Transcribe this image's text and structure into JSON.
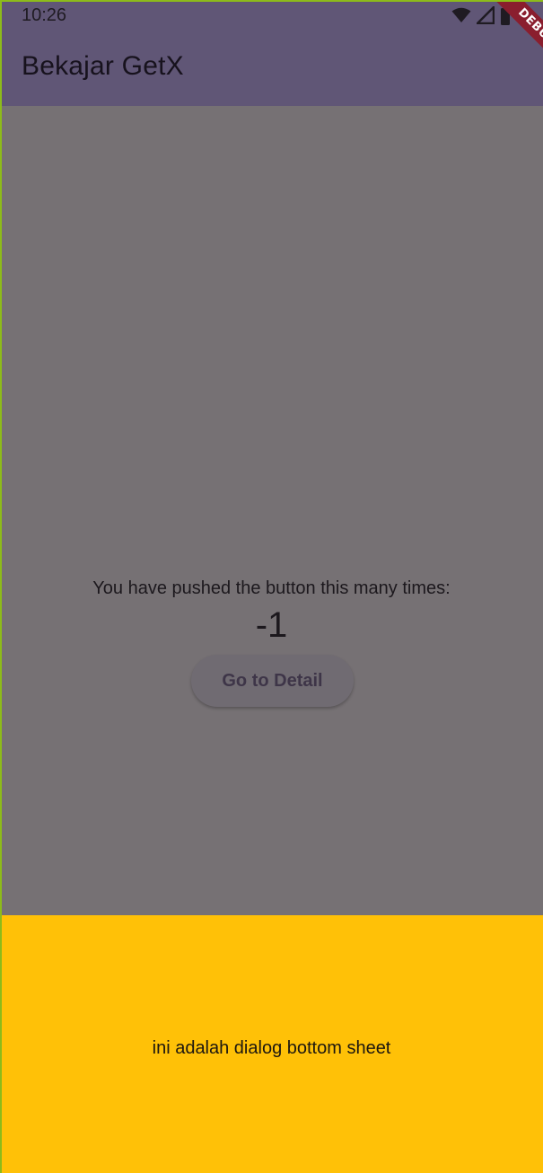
{
  "status_bar": {
    "time": "10:26",
    "icons": [
      "wifi-icon",
      "cellular-signal-icon",
      "battery-icon"
    ]
  },
  "app_bar": {
    "title": "Bekajar GetX"
  },
  "debug_banner": {
    "label": "DEBUG"
  },
  "main": {
    "counter_label": "You have pushed the button this many times:",
    "counter_value": "-1",
    "detail_button_label": "Go to Detail"
  },
  "bottom_sheet": {
    "text": "ini adalah dialog bottom sheet",
    "background_color": "#ffc107"
  },
  "colors": {
    "app_bar": "#605676",
    "scrim_background": "#767174",
    "accent_border": "#8dbb1a"
  }
}
